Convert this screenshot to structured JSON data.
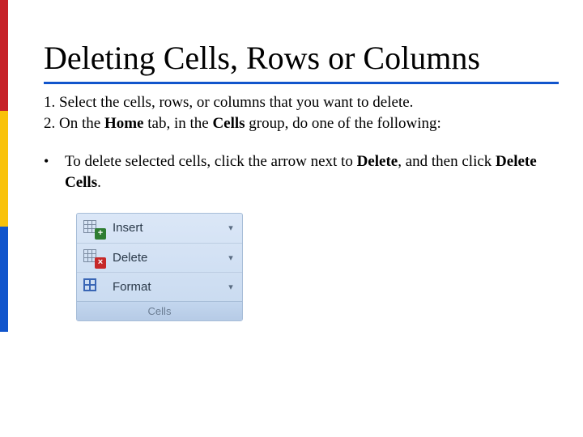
{
  "title": "Deleting Cells, Rows or Columns",
  "steps": {
    "line1_prefix": "1. Select the cells, rows, or columns that you want to delete.",
    "line2_prefix": "2. On the ",
    "line2_bold1": "Home",
    "line2_mid": " tab, in the ",
    "line2_bold2": "Cells",
    "line2_suffix": " group, do one of the following:"
  },
  "bullet": {
    "mark": "•",
    "t1": "To delete selected cells, click the arrow next to ",
    "b1": "Delete",
    "t2": ", and then click ",
    "b2": "Delete Cells",
    "t3": "."
  },
  "ribbon": {
    "rows": [
      {
        "icon": "insert-cells-icon",
        "label": "Insert",
        "dropdown": "▾"
      },
      {
        "icon": "delete-cells-icon",
        "label": "Delete",
        "dropdown": "▾"
      },
      {
        "icon": "format-cells-icon",
        "label": "Format",
        "dropdown": "▾"
      }
    ],
    "footer": "Cells"
  }
}
